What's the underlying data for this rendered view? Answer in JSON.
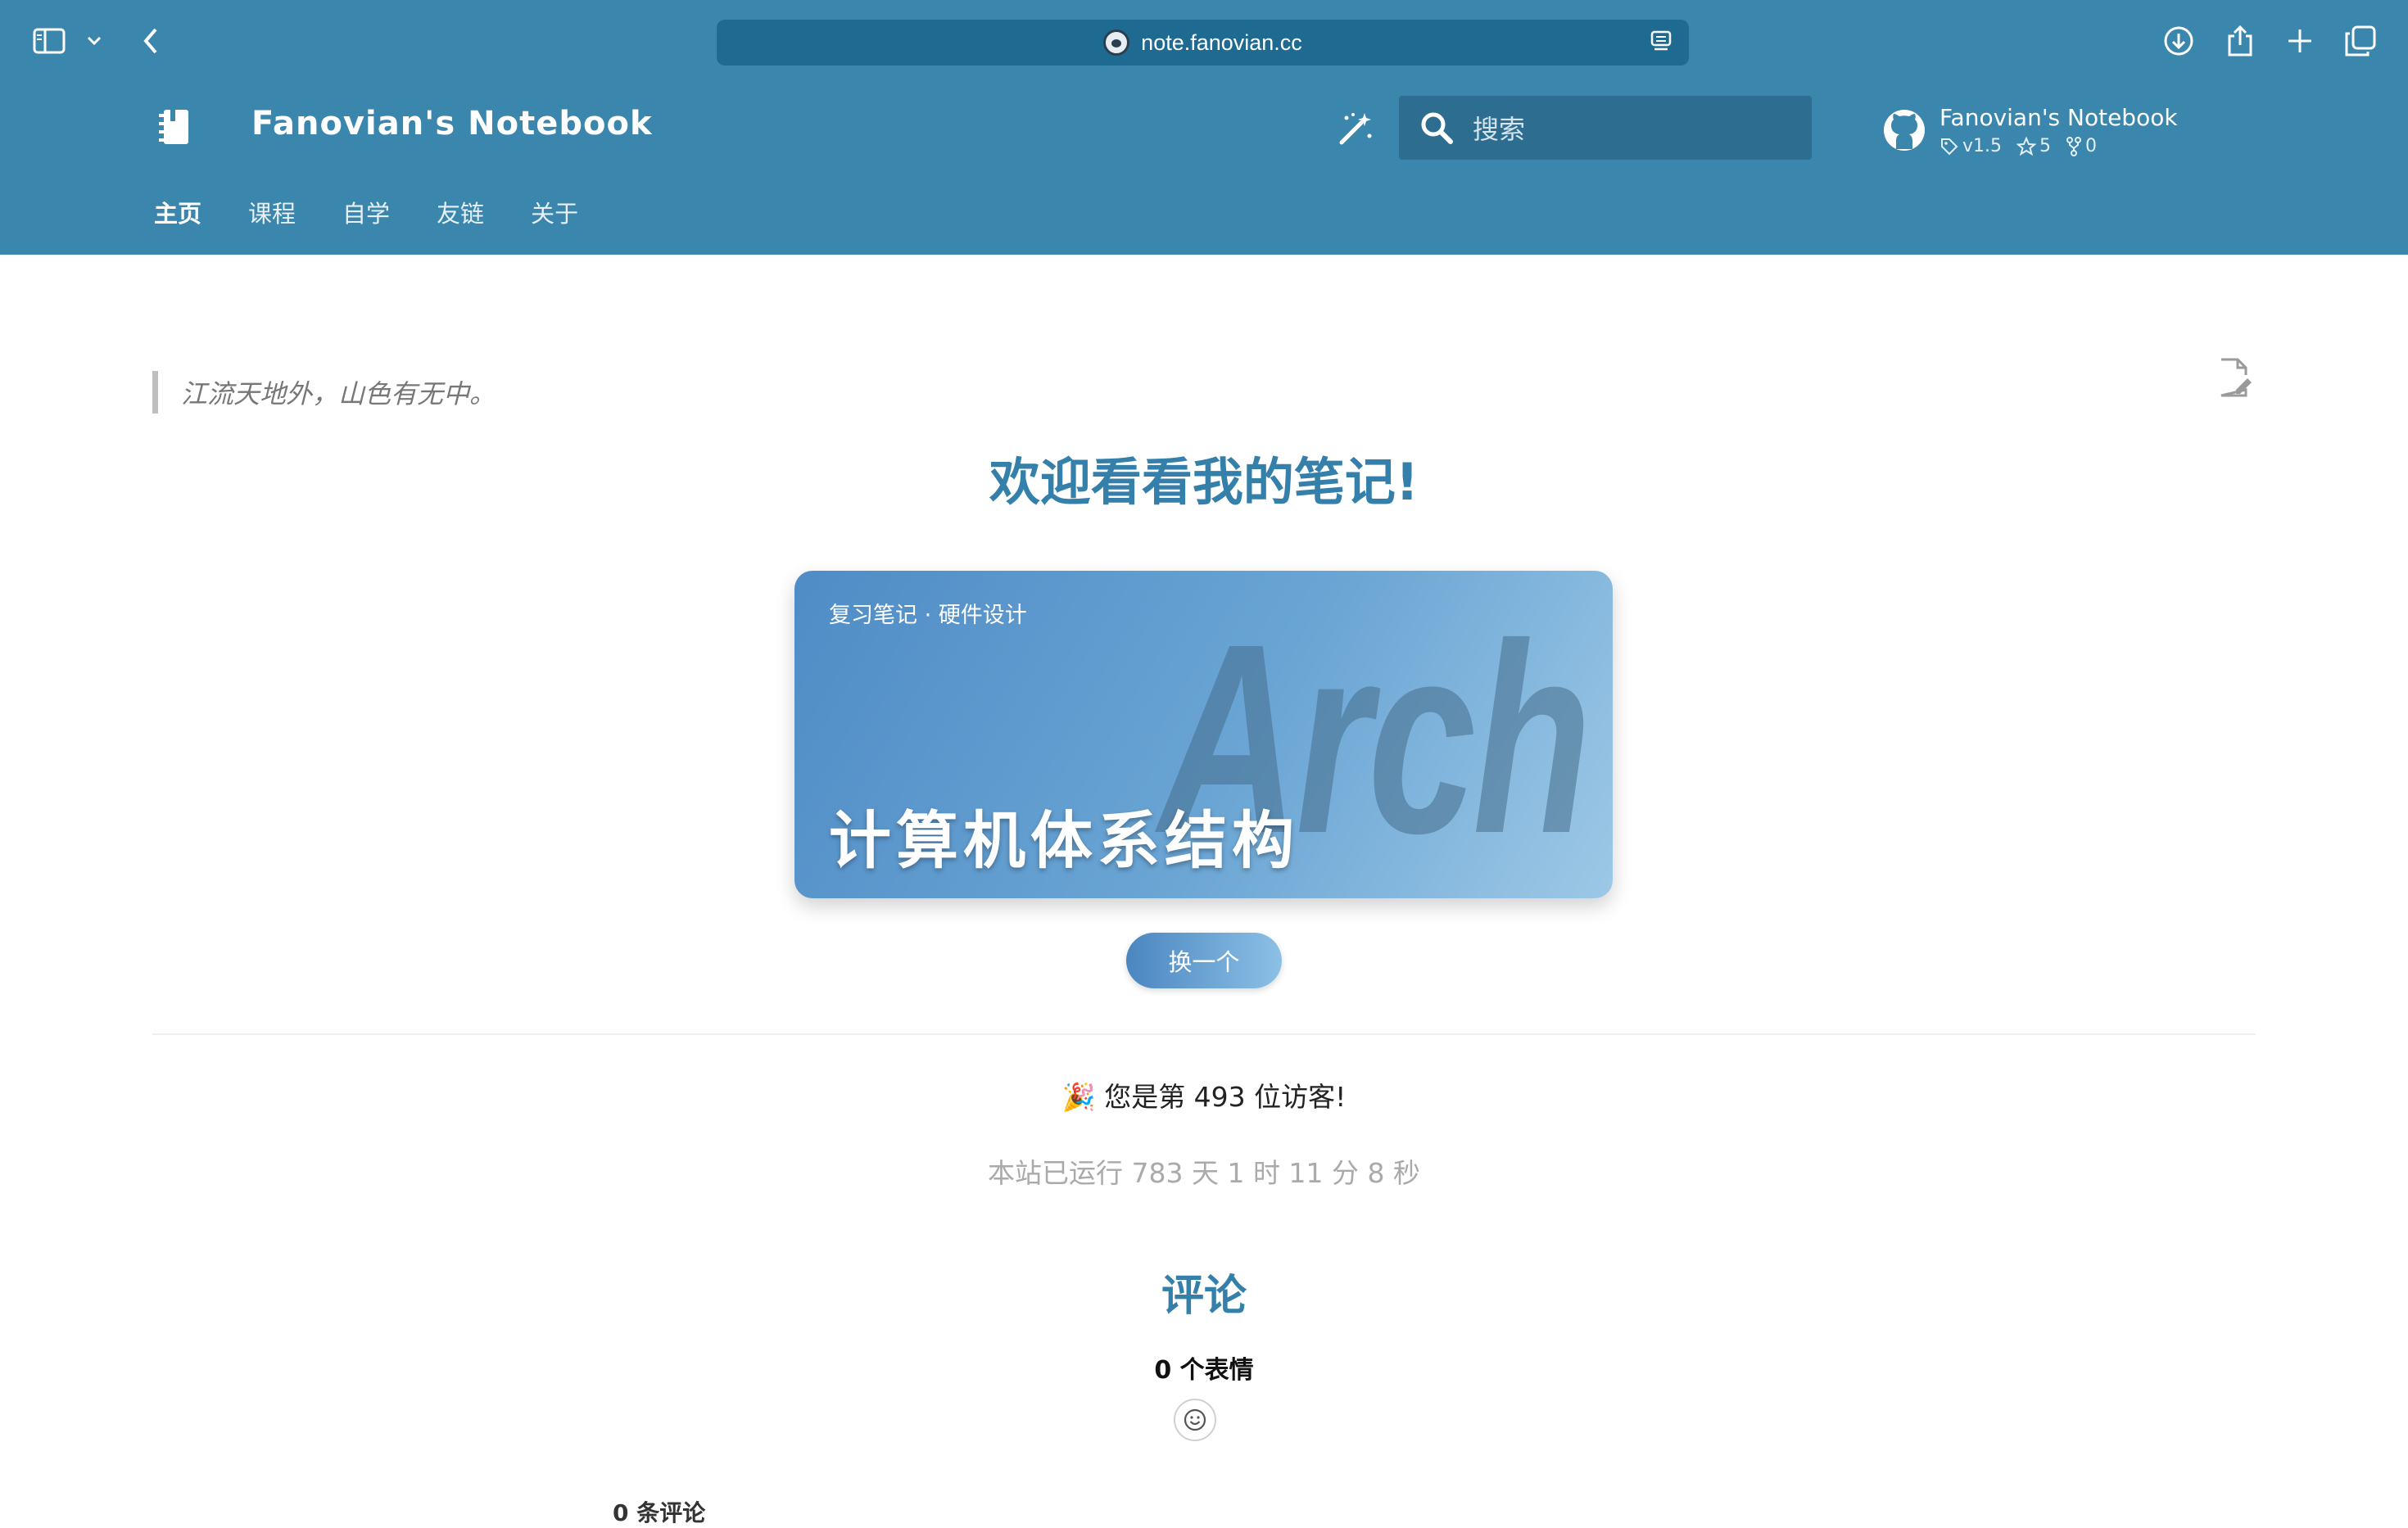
{
  "browser": {
    "url": "note.fanovian.cc",
    "icons": [
      "sidebar-toggle-icon",
      "chevron-down-icon",
      "back-icon",
      "reader-icon",
      "download-icon",
      "share-icon",
      "new-tab-icon",
      "tab-overview-icon"
    ]
  },
  "header": {
    "site_title": "Fanovian's Notebook",
    "search_placeholder": "搜索",
    "repo": {
      "name": "Fanovian's Notebook",
      "version": "v1.5",
      "stars": "5",
      "forks": "0"
    },
    "nav": [
      "主页",
      "课程",
      "自学",
      "友链",
      "关于"
    ]
  },
  "content": {
    "quote": "江流天地外，山色有无中。",
    "title": "欢迎看看我的笔记!",
    "card": {
      "subtitle": "复习笔记 · 硬件设计",
      "title": "计算机体系结构",
      "bg_word": "Arch"
    },
    "switch_button": "换一个",
    "visitor_text": "🎉 您是第 493 位访客!",
    "uptime_text": "本站已运行 783 天 1 时 11 分 8 秒",
    "comments_title": "评论",
    "reactions_label": "0 个表情",
    "comments_count": "0 条评论"
  },
  "colors": {
    "header_bg": "#3b86ad",
    "url_bar_bg": "#1f6a91",
    "accent": "#3580ab"
  }
}
